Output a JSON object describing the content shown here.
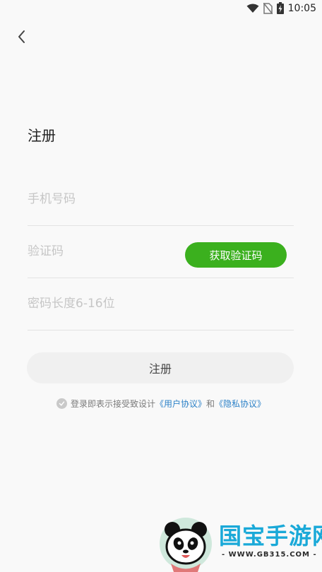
{
  "status_bar": {
    "time": "10:05"
  },
  "header": {
    "title": "注册"
  },
  "form": {
    "phone_placeholder": "手机号码",
    "code_placeholder": "验证码",
    "get_code_label": "获取验证码",
    "password_placeholder": "密码长度6-16位"
  },
  "register_label": "注册",
  "agreement": {
    "prefix": "登录即表示接受致设计",
    "user_agreement": "《用户协议》",
    "and": "和",
    "privacy_agreement": "《隐私协议》"
  },
  "watermark": {
    "name": "国宝手游网",
    "url": "- WWW.GB315.COM -"
  },
  "colors": {
    "accent_green": "#3bb01e",
    "link_blue": "#2d82c8",
    "watermark_blue": "#1aa9d8"
  }
}
